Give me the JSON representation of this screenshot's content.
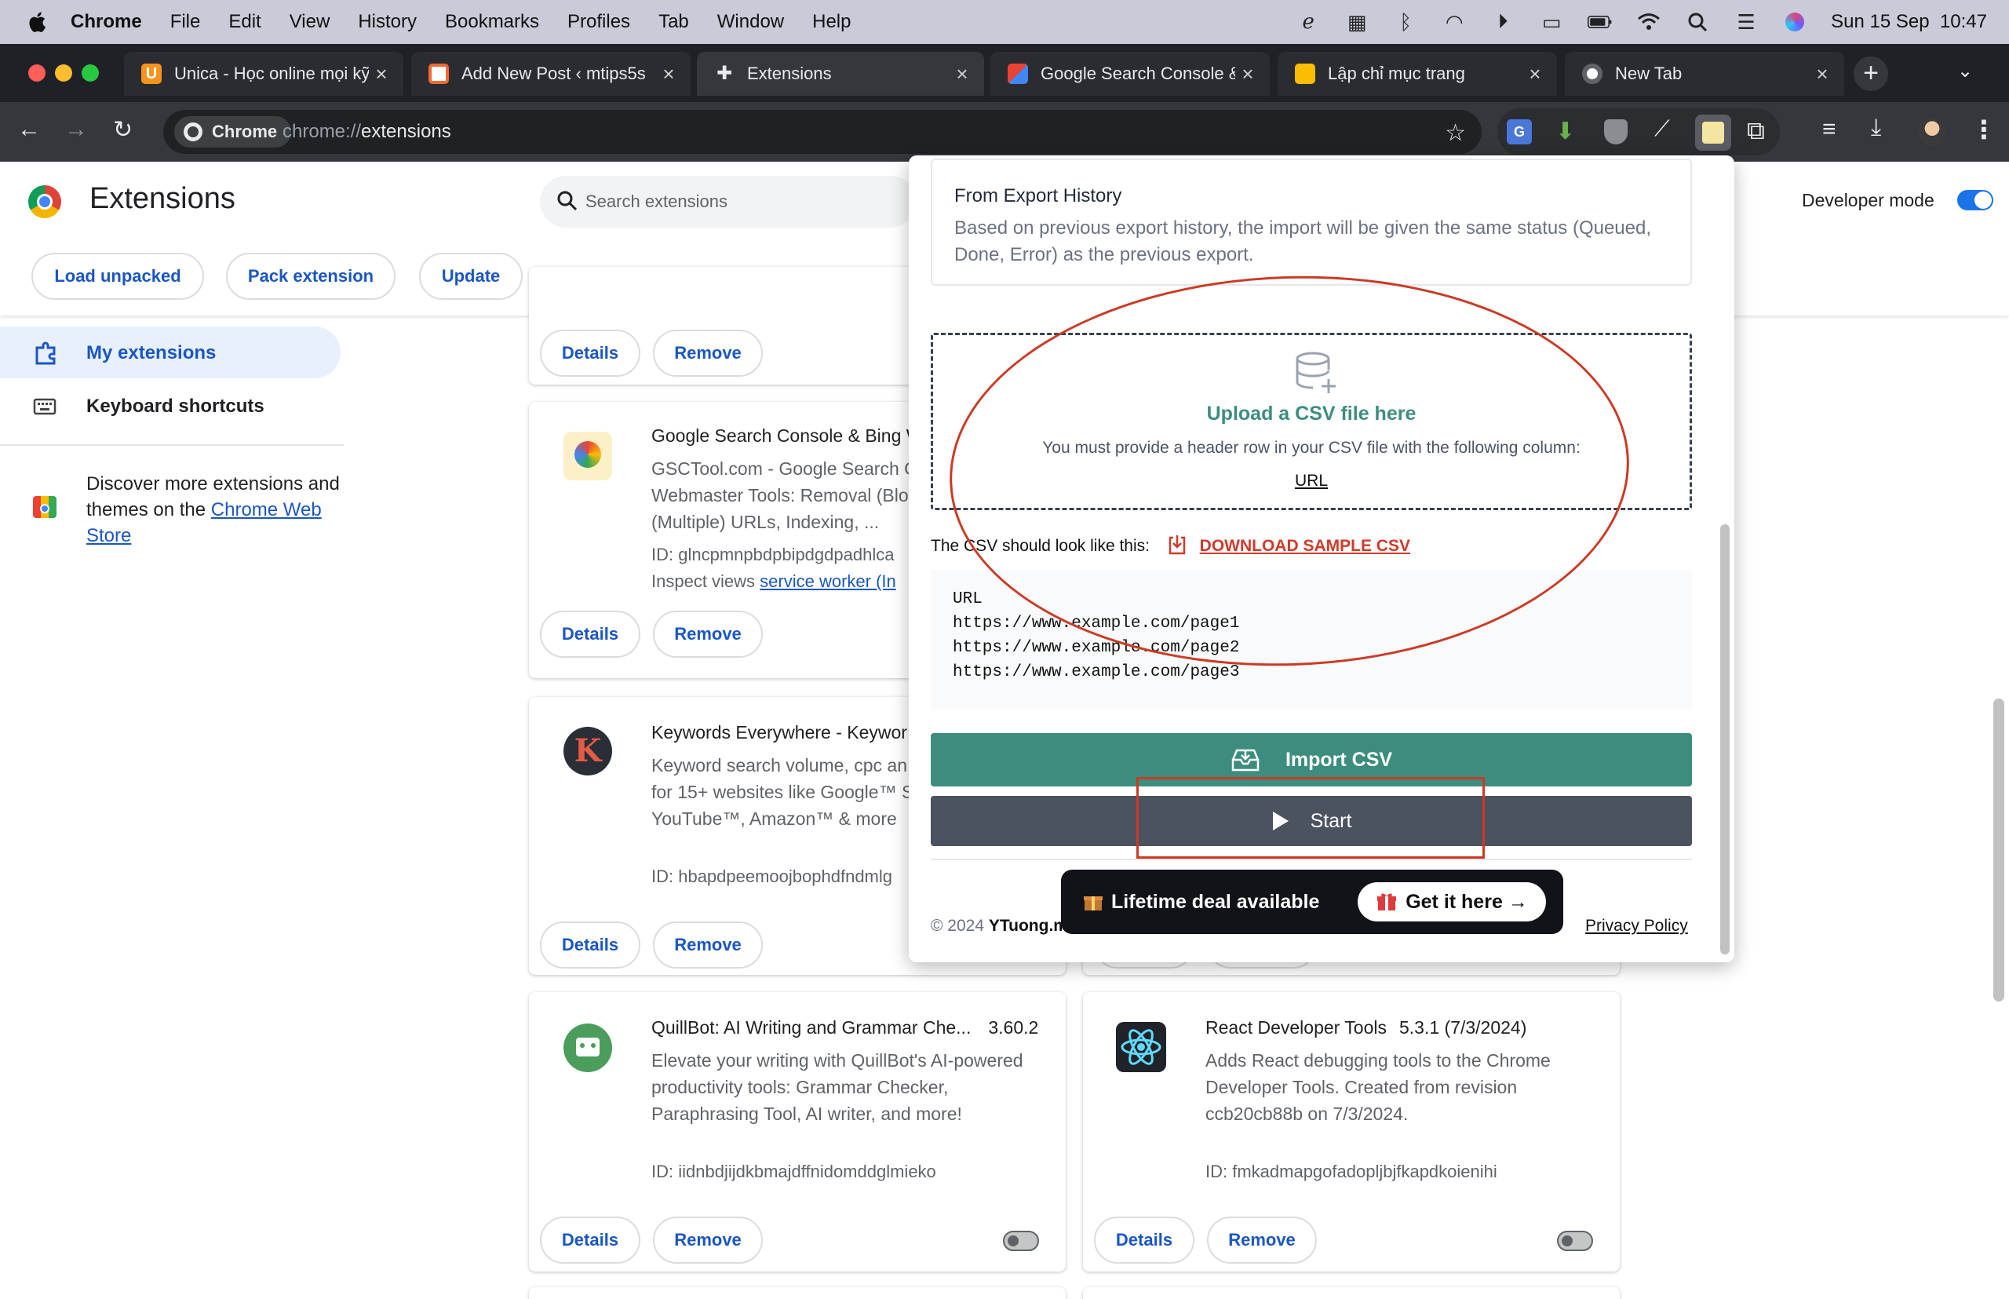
{
  "menubar": {
    "app": "Chrome",
    "items": [
      "File",
      "Edit",
      "View",
      "History",
      "Bookmarks",
      "Profiles",
      "Tab",
      "Window",
      "Help"
    ],
    "datetime": "Sun 15 Sep  10:47"
  },
  "tabs": [
    {
      "title": "Unica - Học online mọi kỹ",
      "favicon_color": "#f7941d"
    },
    {
      "title": "Add New Post ‹ mtips5s",
      "favicon_color": "#f06a35"
    },
    {
      "title": "Extensions",
      "active": true
    },
    {
      "title": "Google Search Console &",
      "favicon_color": "#4285f4"
    },
    {
      "title": "Lập chỉ mục trang",
      "favicon_color": "#fbbc04"
    },
    {
      "title": "New Tab"
    }
  ],
  "toolbar": {
    "chip": "Chrome",
    "url_scheme": "chrome://",
    "url_host": "extensions"
  },
  "header": {
    "title": "Extensions",
    "search_placeholder": "Search extensions",
    "developer_mode": "Developer mode",
    "developer_mode_on": true,
    "buttons": [
      "Load unpacked",
      "Pack extension",
      "Update"
    ]
  },
  "sidebar": {
    "items": [
      {
        "label": "My extensions",
        "selected": true
      },
      {
        "label": "Keyboard shortcuts"
      }
    ],
    "discover_text": "Discover more extensions and themes on the ",
    "discover_link": "Chrome Web Store"
  },
  "cards": [
    {
      "name": "Google Search Console & Bing W",
      "desc": [
        "GSCTool.com - Google Search C",
        "Webmaster Tools: Removal (Blo",
        "(Multiple) URLs, Indexing, ..."
      ],
      "id": "ID: glncpmnpbdpbipdgdpadhlca",
      "inspect": "Inspect views ",
      "inspect_link": "service worker (In"
    },
    {
      "name": "Keywords Everywhere - Keywor",
      "desc": [
        "Keyword search volume, cpc an",
        "for 15+ websites like Google™ S",
        "YouTube™, Amazon™ & more"
      ],
      "id": "ID: hbapdpeemoojbophdfndmlg"
    },
    {
      "name": "QuillBot: AI Writing and Grammar Che...",
      "version": "3.60.2",
      "desc": [
        "Elevate your writing with QuillBot's AI-powered",
        "productivity tools: Grammar Checker,",
        "Paraphrasing Tool, AI writer, and more!"
      ],
      "id": "ID: iidnbdjijdkbmajdffnidomddglmieko",
      "enabled": false
    },
    {
      "name": "React Developer Tools",
      "version": "5.3.1 (7/3/2024)",
      "desc": [
        "Adds React debugging tools to the Chrome",
        "Developer Tools. Created from revision",
        "ccb20cb88b on 7/3/2024."
      ],
      "id": "ID: fmkadmapgofadopljbjfkapdkoienihi",
      "enabled": false
    }
  ],
  "card_buttons": {
    "details": "Details",
    "remove": "Remove"
  },
  "popup": {
    "export_title": "From Export History",
    "export_desc": "Based on previous export history, the import will be given the same status (Queued, Done, Error) as the previous export.",
    "upload_title": "Upload a CSV file here",
    "upload_req": "You must provide a header row in your CSV file with the following column:",
    "upload_col": "URL",
    "csv_look": "The CSV should look like this:",
    "download_sample": "DOWNLOAD SAMPLE CSV",
    "code_lines": [
      "URL",
      "https://www.example.com/page1",
      "https://www.example.com/page2",
      "https://www.example.com/page3"
    ],
    "import_btn": "Import CSV",
    "start_btn": "Start",
    "copyright_prefix": "© 2024 ",
    "copyright_brand": "YTuong.m",
    "privacy": "Privacy Policy",
    "deal_text": "Lifetime deal available",
    "deal_btn": "Get it here →"
  },
  "colors": {
    "accent_blue": "#1a73e8",
    "popup_green": "#3d8d7f",
    "start_gray": "#4b5260",
    "annotation_red": "#cc3a24"
  }
}
